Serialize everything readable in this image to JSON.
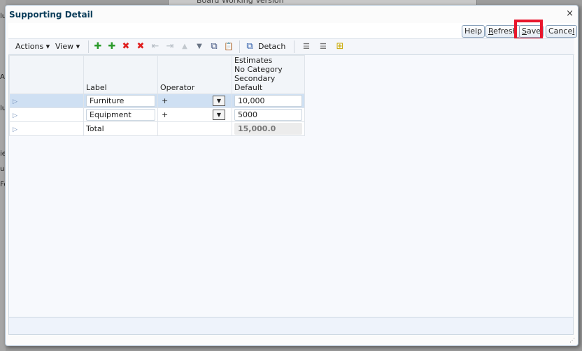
{
  "background": {
    "strip_text": "Board Working Version",
    "left_fragments": [
      "lu",
      "A",
      "lu",
      "ie",
      "ui",
      "Fo"
    ]
  },
  "dialog": {
    "title": "Supporting Detail",
    "close_glyph": "×",
    "buttons": {
      "help": "Help",
      "refresh_underline": "R",
      "refresh_rest": "efresh",
      "save_underline": "S",
      "save_rest": "ave",
      "cancel_rest": "Cance",
      "cancel_underline": "l"
    },
    "highlight_color": "#e8162c"
  },
  "toolbar": {
    "actions": "Actions ▾",
    "view": "View ▾",
    "detach": "Detach",
    "icons": [
      {
        "name": "add-child-icon",
        "glyph": "✚"
      },
      {
        "name": "add-sibling-icon",
        "glyph": "✚"
      },
      {
        "name": "delete-icon",
        "glyph": "✖"
      },
      {
        "name": "delete-all-icon",
        "glyph": "✖"
      },
      {
        "name": "promote-icon",
        "glyph": "⇤"
      },
      {
        "name": "demote-icon",
        "glyph": "⇥"
      },
      {
        "name": "move-up-icon",
        "glyph": "▲"
      },
      {
        "name": "move-down-icon",
        "glyph": "▼"
      },
      {
        "name": "copy-icon",
        "glyph": "⧉"
      },
      {
        "name": "paste-icon",
        "glyph": "📋"
      }
    ],
    "right_icons": [
      {
        "name": "expand-all-icon",
        "glyph": "≣"
      },
      {
        "name": "collapse-all-icon",
        "glyph": "≣"
      },
      {
        "name": "hierarchy-icon",
        "glyph": "⊞"
      }
    ]
  },
  "grid": {
    "headers": {
      "label": "Label",
      "operator": "Operator",
      "estimates_line1": "Estimates",
      "estimates_line2": "No Category",
      "estimates_line3": "Secondary Default"
    },
    "rows": [
      {
        "label": "Furniture",
        "operator": "+",
        "value": "10,000"
      },
      {
        "label": "Equipment",
        "operator": "+",
        "value": "5000"
      },
      {
        "label": "Total",
        "operator": "",
        "value": "15,000.0"
      }
    ]
  }
}
